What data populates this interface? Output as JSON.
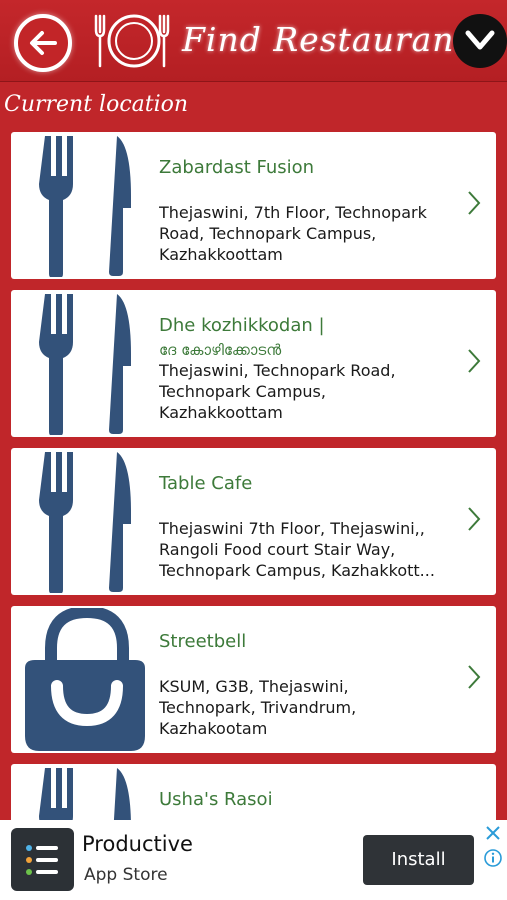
{
  "header": {
    "title": "Find Restaurants",
    "back_icon": "back-arrow-icon",
    "logo_icon": "plate-cutlery-icon",
    "menu_icon": "chevron-down-icon"
  },
  "section_label": "Current location",
  "restaurants": [
    {
      "name": "Zabardast Fusion",
      "address": [
        "Thejaswini, 7th Floor, Technopark",
        "Road, Technopark Campus,",
        "Kazhakkoottam"
      ],
      "icon": "fork-knife-icon"
    },
    {
      "name": "Dhe kozhikkodan |",
      "name_local": "ദേ കോഴിക്കോടൻ",
      "address": [
        "Thejaswini, Technopark Road,",
        "Technopark Campus,",
        "Kazhakkoottam"
      ],
      "icon": "fork-knife-icon"
    },
    {
      "name": "Table Cafe",
      "address": [
        "Thejaswini 7th Floor, Thejaswini,,",
        "Rangoli Food court Stair Way,",
        "Technopark Campus, Kazhakkott..."
      ],
      "icon": "fork-knife-icon"
    },
    {
      "name": "Streetbell",
      "address": [
        "KSUM, G3B, Thejaswini,",
        "Technopark, Trivandrum,",
        "Kazhakootam"
      ],
      "icon": "shopping-bag-icon"
    },
    {
      "name": "Usha's Rasoi",
      "address": [],
      "icon": "fork-knife-icon"
    }
  ],
  "ad": {
    "title": "Productive",
    "subtitle": "App Store",
    "install_label": "Install",
    "icon": "checklist-app-icon"
  },
  "colors": {
    "background_red": "#c0262a",
    "name_green": "#3d7a3a",
    "icon_blue": "#33527a",
    "ad_dark": "#2f3337"
  }
}
